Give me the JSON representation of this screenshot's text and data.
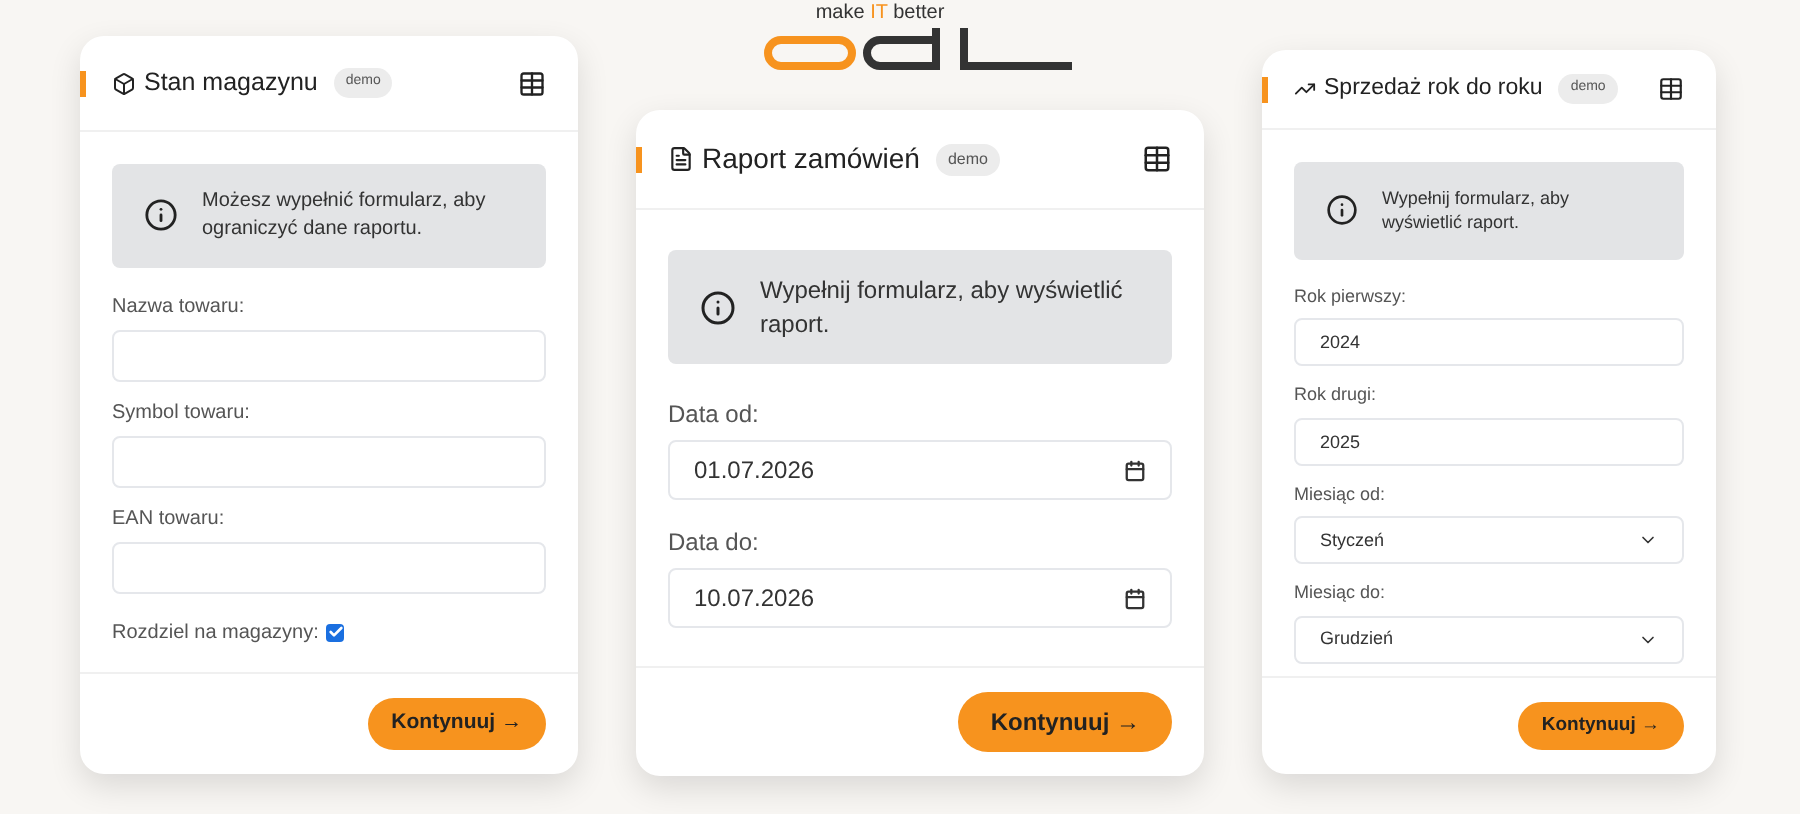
{
  "logo": {
    "tagline_parts": [
      {
        "text": "make ",
        "accent": false
      },
      {
        "text": "IT",
        "accent": true
      },
      {
        "text": " better",
        "accent": false
      }
    ]
  },
  "cards": [
    {
      "kind": "box",
      "title": "Stan magazynu",
      "badge": "demo",
      "info": "Możesz wypełnić formularz, aby ograniczyć dane raportu.",
      "fields": [
        {
          "kind": "text",
          "label": "Nazwa towaru:"
        },
        {
          "kind": "text",
          "label": "Symbol towaru:"
        },
        {
          "kind": "text",
          "label": "EAN towaru:"
        },
        {
          "kind": "checkbox",
          "label": "Rozdziel na magazyny:",
          "checked": true
        }
      ],
      "button": "Kontynuuj →"
    },
    {
      "kind": "file",
      "title": "Raport zamówień",
      "badge": "demo",
      "info": "Wypełnij formularz, aby wyświetlić raport.",
      "fields": [
        {
          "kind": "date",
          "label": "Data od:",
          "value": "01.07.2026"
        },
        {
          "kind": "date",
          "label": "Data do:",
          "value": "10.07.2026"
        }
      ],
      "button": "Kontynuuj →"
    },
    {
      "kind": "trend",
      "title": "Sprzedaż rok do roku",
      "badge": "demo",
      "info": "Wypełnij formularz, aby wyświetlić raport.",
      "fields": [
        {
          "kind": "text",
          "label": "Rok pierwszy:",
          "value": "2024"
        },
        {
          "kind": "text",
          "label": "Rok drugi:",
          "value": "2025"
        },
        {
          "kind": "select",
          "label": "Miesiąc od:",
          "value": "Styczeń"
        },
        {
          "kind": "select",
          "label": "Miesiąc do:",
          "value": "Grudzień"
        }
      ],
      "button": "Kontynuuj →"
    }
  ]
}
